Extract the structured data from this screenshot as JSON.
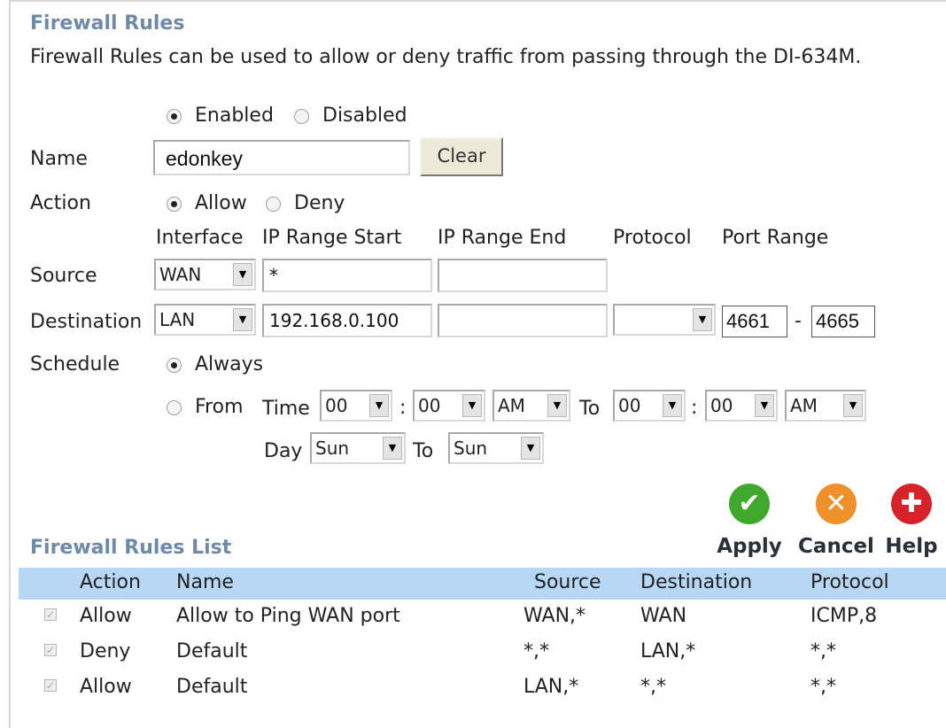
{
  "section": {
    "title": "Firewall Rules",
    "description": "Firewall Rules can be used to allow or deny traffic from passing through the DI-634M."
  },
  "rule_state": {
    "enabled_label": "Enabled",
    "disabled_label": "Disabled",
    "selected": "Enabled"
  },
  "name": {
    "label": "Name",
    "value": "edonkey",
    "clear_label": "Clear"
  },
  "action": {
    "label": "Action",
    "allow_label": "Allow",
    "deny_label": "Deny",
    "selected": "Allow"
  },
  "columns": {
    "interface": "Interface",
    "ip_start": "IP Range Start",
    "ip_end": "IP Range End",
    "protocol": "Protocol",
    "port_range": "Port Range"
  },
  "source": {
    "label": "Source",
    "interface": "WAN",
    "ip_start": "*",
    "ip_end": ""
  },
  "destination": {
    "label": "Destination",
    "interface": "LAN",
    "ip_start": "192.168.0.100",
    "ip_end": "",
    "protocol": "",
    "port_start": "4661",
    "port_separator": "-",
    "port_end": "4665"
  },
  "schedule": {
    "label": "Schedule",
    "always_label": "Always",
    "from_label": "From",
    "time_label": "Time",
    "to_label": "To",
    "day_label": "Day",
    "colon": ":",
    "selected": "Always",
    "from_hour": "00",
    "from_minute": "00",
    "from_ampm": "AM",
    "to_hour": "00",
    "to_minute": "00",
    "to_ampm": "AM",
    "day_from": "Sun",
    "day_to": "Sun"
  },
  "buttons": {
    "apply": {
      "label": "Apply",
      "icon": "check-icon",
      "color": "#3ea92c"
    },
    "cancel": {
      "label": "Cancel",
      "icon": "x-icon",
      "color": "#f0902a"
    },
    "help": {
      "label": "Help",
      "icon": "plus-icon",
      "color": "#d8222a"
    }
  },
  "rules_list": {
    "title": "Firewall Rules List",
    "headers": [
      "Action",
      "Name",
      "Source",
      "Destination",
      "Protocol"
    ],
    "rows": [
      {
        "checked": true,
        "action": "Allow",
        "name": "Allow to Ping WAN port",
        "source": "WAN,*",
        "destination": "WAN",
        "protocol": "ICMP,8"
      },
      {
        "checked": true,
        "action": "Deny",
        "name": "Default",
        "source": "*,*",
        "destination": "LAN,*",
        "protocol": "*,*"
      },
      {
        "checked": true,
        "action": "Allow",
        "name": "Default",
        "source": "LAN,*",
        "destination": "*,*",
        "protocol": "*,*"
      }
    ]
  },
  "colors": {
    "heading": "#6f8aa8",
    "list_header_bg": "#b7d7f4"
  }
}
